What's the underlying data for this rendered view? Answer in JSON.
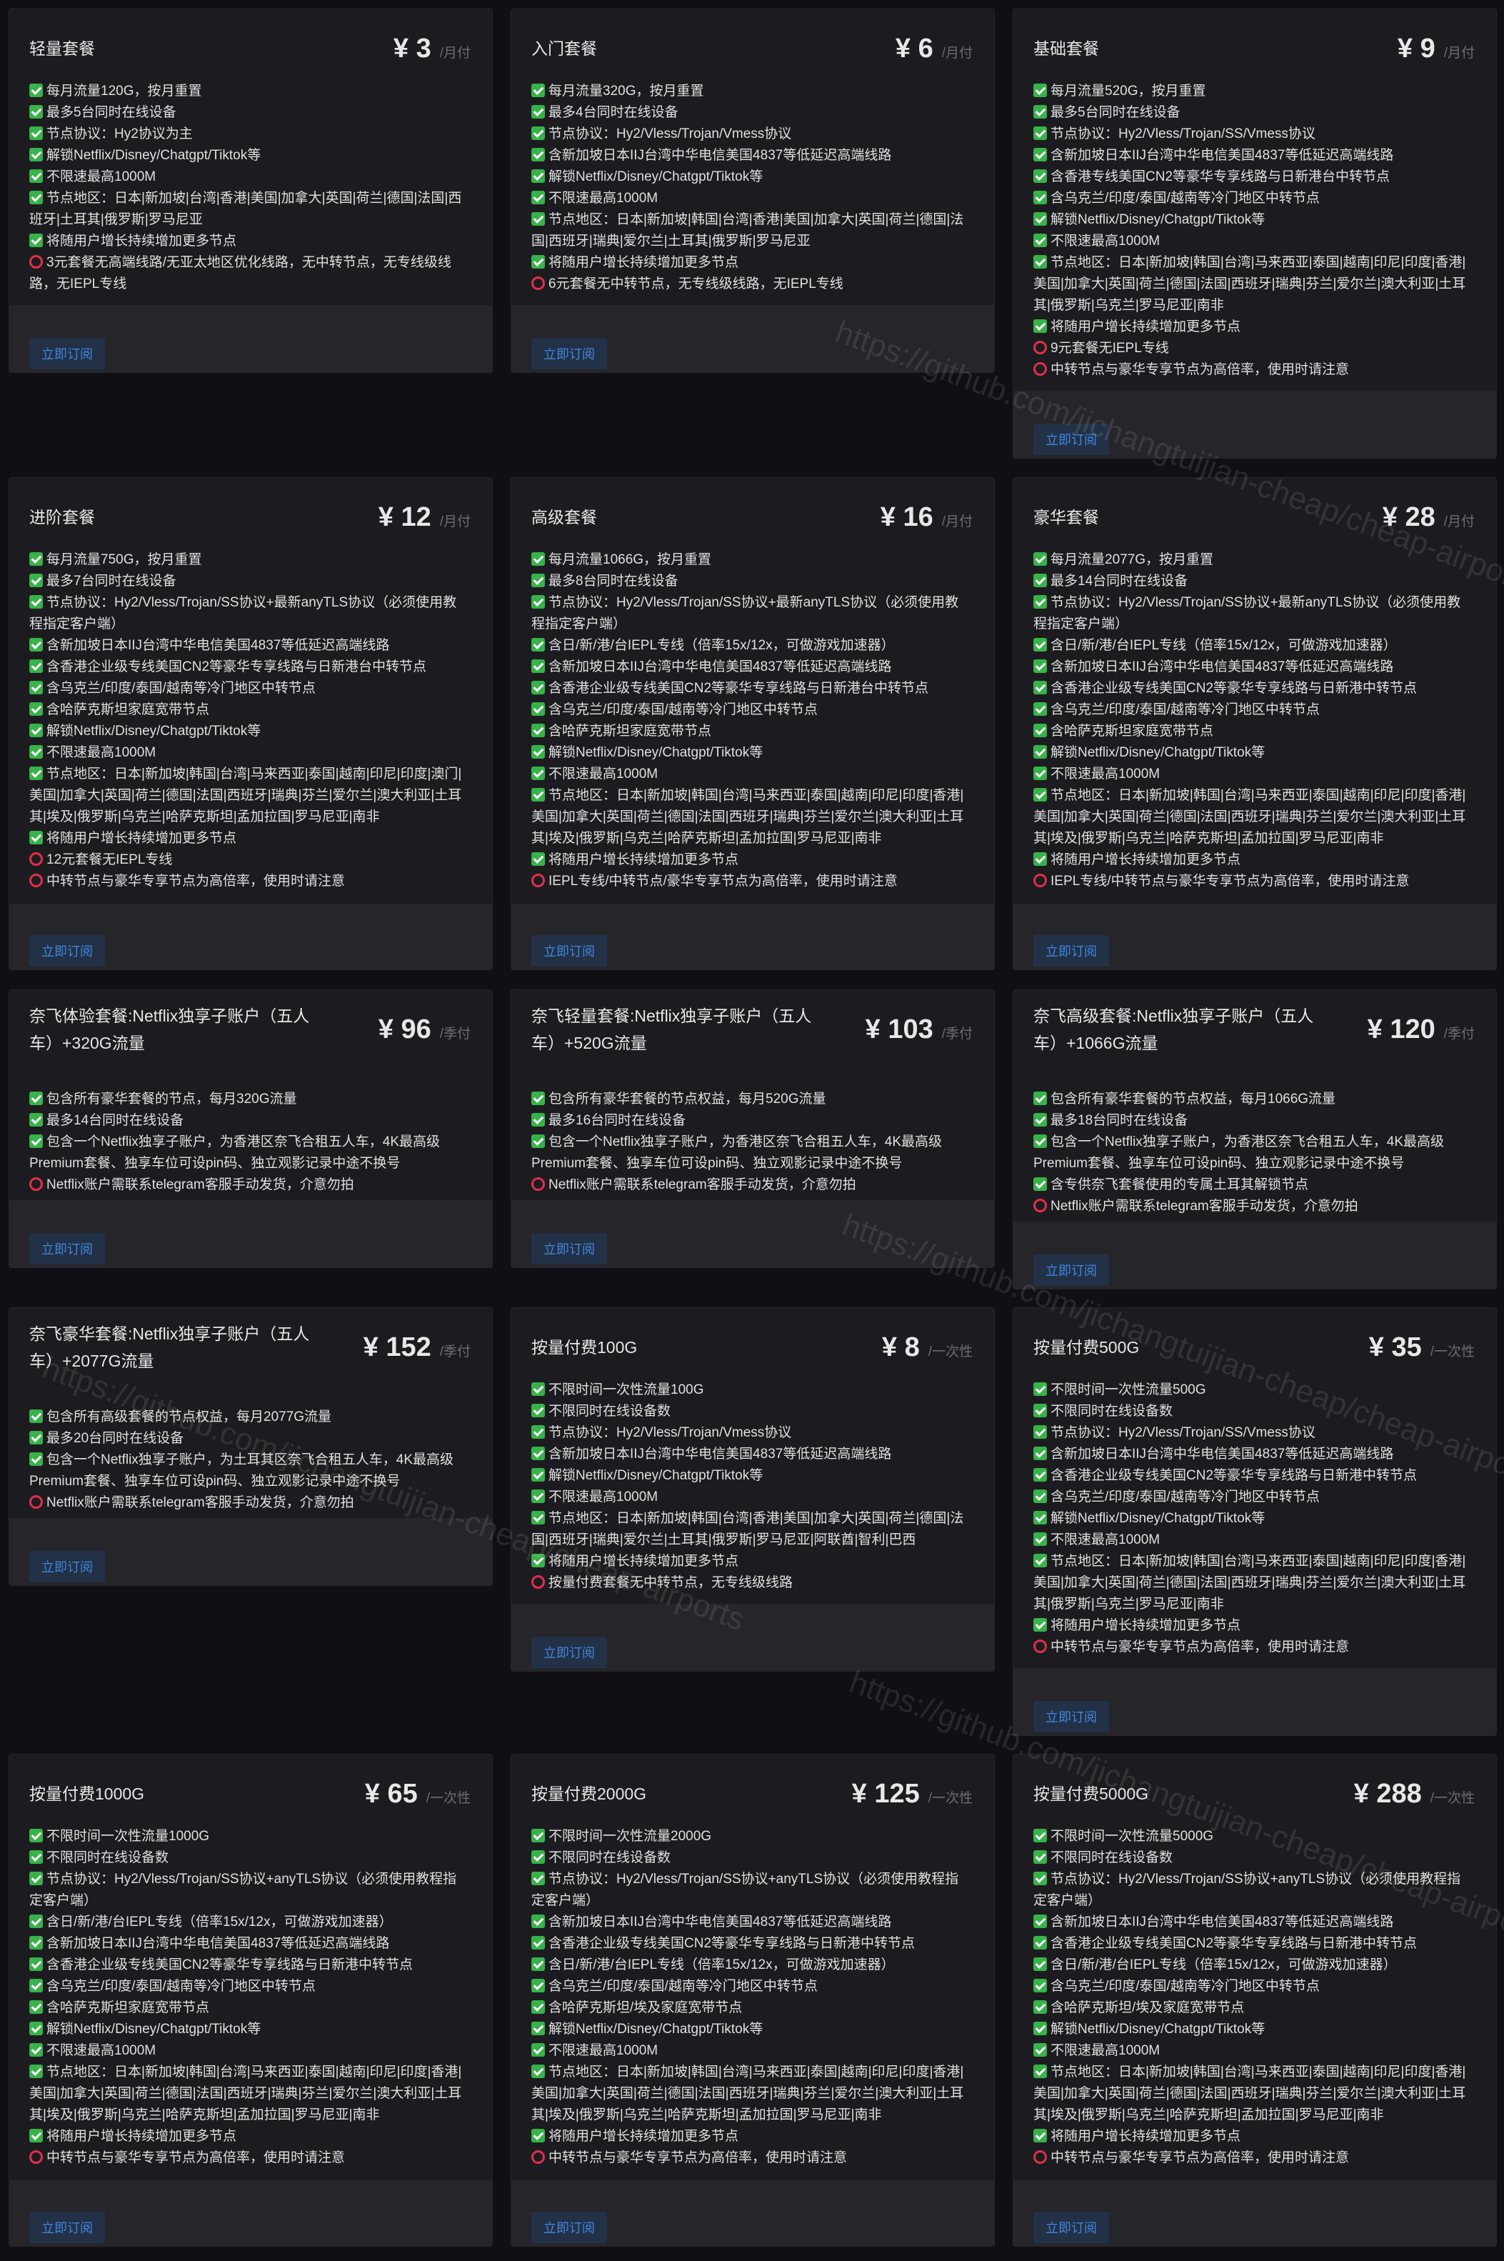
{
  "watermark": "https://github.com/jichangtuijian-cheap/cheap-airports",
  "colors": {
    "background": "#101014",
    "card": "#1c1c20",
    "check": "#38b24a",
    "circle": "#e0304a",
    "button_text": "#3f86e0",
    "button_bg": "#223146"
  },
  "icons": {
    "check": "check-square-icon",
    "circle": "red-circle-icon"
  },
  "plans": [
    {
      "title": "轻量套餐",
      "price": "¥ 3",
      "unit": "/月付",
      "button": "立即订阅",
      "features": [
        {
          "icon": "check",
          "text": "每月流量120G，按月重置"
        },
        {
          "icon": "check",
          "text": "最多5台同时在线设备"
        },
        {
          "icon": "check",
          "text": "节点协议：Hy2协议为主"
        },
        {
          "icon": "check",
          "text": "解锁Netflix/Disney/Chatgpt/Tiktok等"
        },
        {
          "icon": "check",
          "text": "不限速最高1000M"
        },
        {
          "icon": "check",
          "text": "节点地区：日本|新加坡|台湾|香港|美国|加拿大|英国|荷兰|德国|法国|西班牙|土耳其|俄罗斯|罗马尼亚"
        },
        {
          "icon": "check",
          "text": "将随用户增长持续增加更多节点"
        },
        {
          "icon": "circle",
          "text": "3元套餐无高端线路/无亚太地区优化线路，无中转节点，无专线级线路，无IEPL专线"
        }
      ]
    },
    {
      "title": "入门套餐",
      "price": "¥ 6",
      "unit": "/月付",
      "button": "立即订阅",
      "features": [
        {
          "icon": "check",
          "text": "每月流量320G，按月重置"
        },
        {
          "icon": "check",
          "text": "最多4台同时在线设备"
        },
        {
          "icon": "check",
          "text": "节点协议：Hy2/Vless/Trojan/Vmess协议"
        },
        {
          "icon": "check",
          "text": "含新加坡日本IIJ台湾中华电信美国4837等低延迟高端线路"
        },
        {
          "icon": "check",
          "text": "解锁Netflix/Disney/Chatgpt/Tiktok等"
        },
        {
          "icon": "check",
          "text": "不限速最高1000M"
        },
        {
          "icon": "check",
          "text": "节点地区：日本|新加坡|韩国|台湾|香港|美国|加拿大|英国|荷兰|德国|法国|西班牙|瑞典|爱尔兰|土耳其|俄罗斯|罗马尼亚"
        },
        {
          "icon": "check",
          "text": "将随用户增长持续增加更多节点"
        },
        {
          "icon": "circle",
          "text": "6元套餐无中转节点，无专线级线路，无IEPL专线"
        }
      ]
    },
    {
      "title": "基础套餐",
      "price": "¥ 9",
      "unit": "/月付",
      "button": "立即订阅",
      "features": [
        {
          "icon": "check",
          "text": "每月流量520G，按月重置"
        },
        {
          "icon": "check",
          "text": "最多5台同时在线设备"
        },
        {
          "icon": "check",
          "text": "节点协议：Hy2/Vless/Trojan/SS/Vmess协议"
        },
        {
          "icon": "check",
          "text": "含新加坡日本IIJ台湾中华电信美国4837等低延迟高端线路"
        },
        {
          "icon": "check",
          "text": "含香港专线美国CN2等豪华专享线路与日新港台中转节点"
        },
        {
          "icon": "check",
          "text": "含乌克兰/印度/泰国/越南等冷门地区中转节点"
        },
        {
          "icon": "check",
          "text": "解锁Netflix/Disney/Chatgpt/Tiktok等"
        },
        {
          "icon": "check",
          "text": "不限速最高1000M"
        },
        {
          "icon": "check",
          "text": "节点地区：日本|新加坡|韩国|台湾|马来西亚|泰国|越南|印尼|印度|香港|美国|加拿大|英国|荷兰|德国|法国|西班牙|瑞典|芬兰|爱尔兰|澳大利亚|土耳其|俄罗斯|乌克兰|罗马尼亚|南非"
        },
        {
          "icon": "check",
          "text": "将随用户增长持续增加更多节点"
        },
        {
          "icon": "circle",
          "text": "9元套餐无IEPL专线"
        },
        {
          "icon": "circle",
          "text": "中转节点与豪华专享节点为高倍率，使用时请注意"
        }
      ]
    },
    {
      "title": "进阶套餐",
      "price": "¥ 12",
      "unit": "/月付",
      "button": "立即订阅",
      "features": [
        {
          "icon": "check",
          "text": "每月流量750G，按月重置"
        },
        {
          "icon": "check",
          "text": "最多7台同时在线设备"
        },
        {
          "icon": "check",
          "text": "节点协议：Hy2/Vless/Trojan/SS协议+最新anyTLS协议（必须使用教程指定客户端）"
        },
        {
          "icon": "check",
          "text": "含新加坡日本IIJ台湾中华电信美国4837等低延迟高端线路"
        },
        {
          "icon": "check",
          "text": "含香港企业级专线美国CN2等豪华专享线路与日新港台中转节点"
        },
        {
          "icon": "check",
          "text": "含乌克兰/印度/泰国/越南等冷门地区中转节点"
        },
        {
          "icon": "check",
          "text": "含哈萨克斯坦家庭宽带节点"
        },
        {
          "icon": "check",
          "text": "解锁Netflix/Disney/Chatgpt/Tiktok等"
        },
        {
          "icon": "check",
          "text": "不限速最高1000M"
        },
        {
          "icon": "check",
          "text": "节点地区：日本|新加坡|韩国|台湾|马来西亚|泰国|越南|印尼|印度|澳门|美国|加拿大|英国|荷兰|德国|法国|西班牙|瑞典|芬兰|爱尔兰|澳大利亚|土耳其|埃及|俄罗斯|乌克兰|哈萨克斯坦|孟加拉国|罗马尼亚|南非"
        },
        {
          "icon": "check",
          "text": "将随用户增长持续增加更多节点"
        },
        {
          "icon": "circle",
          "text": "12元套餐无IEPL专线"
        },
        {
          "icon": "circle",
          "text": "中转节点与豪华专享节点为高倍率，使用时请注意"
        }
      ]
    },
    {
      "title": "高级套餐",
      "price": "¥ 16",
      "unit": "/月付",
      "button": "立即订阅",
      "features": [
        {
          "icon": "check",
          "text": "每月流量1066G，按月重置"
        },
        {
          "icon": "check",
          "text": "最多8台同时在线设备"
        },
        {
          "icon": "check",
          "text": "节点协议：Hy2/Vless/Trojan/SS协议+最新anyTLS协议（必须使用教程指定客户端）"
        },
        {
          "icon": "check",
          "text": "含日/新/港/台IEPL专线（倍率15x/12x，可做游戏加速器）"
        },
        {
          "icon": "check",
          "text": "含新加坡日本IIJ台湾中华电信美国4837等低延迟高端线路"
        },
        {
          "icon": "check",
          "text": "含香港企业级专线美国CN2等豪华专享线路与日新港台中转节点"
        },
        {
          "icon": "check",
          "text": "含乌克兰/印度/泰国/越南等冷门地区中转节点"
        },
        {
          "icon": "check",
          "text": "含哈萨克斯坦家庭宽带节点"
        },
        {
          "icon": "check",
          "text": "解锁Netflix/Disney/Chatgpt/Tiktok等"
        },
        {
          "icon": "check",
          "text": "不限速最高1000M"
        },
        {
          "icon": "check",
          "text": "节点地区：日本|新加坡|韩国|台湾|马来西亚|泰国|越南|印尼|印度|香港|美国|加拿大|英国|荷兰|德国|法国|西班牙|瑞典|芬兰|爱尔兰|澳大利亚|土耳其|埃及|俄罗斯|乌克兰|哈萨克斯坦|孟加拉国|罗马尼亚|南非"
        },
        {
          "icon": "check",
          "text": "将随用户增长持续增加更多节点"
        },
        {
          "icon": "circle",
          "text": "IEPL专线/中转节点/豪华专享节点为高倍率，使用时请注意"
        }
      ]
    },
    {
      "title": "豪华套餐",
      "price": "¥ 28",
      "unit": "/月付",
      "button": "立即订阅",
      "features": [
        {
          "icon": "check",
          "text": "每月流量2077G，按月重置"
        },
        {
          "icon": "check",
          "text": "最多14台同时在线设备"
        },
        {
          "icon": "check",
          "text": "节点协议：Hy2/Vless/Trojan/SS协议+最新anyTLS协议（必须使用教程指定客户端）"
        },
        {
          "icon": "check",
          "text": "含日/新/港/台IEPL专线（倍率15x/12x，可做游戏加速器）"
        },
        {
          "icon": "check",
          "text": "含新加坡日本IIJ台湾中华电信美国4837等低延迟高端线路"
        },
        {
          "icon": "check",
          "text": "含香港企业级专线美国CN2等豪华专享线路与日新港中转节点"
        },
        {
          "icon": "check",
          "text": "含乌克兰/印度/泰国/越南等冷门地区中转节点"
        },
        {
          "icon": "check",
          "text": "含哈萨克斯坦家庭宽带节点"
        },
        {
          "icon": "check",
          "text": "解锁Netflix/Disney/Chatgpt/Tiktok等"
        },
        {
          "icon": "check",
          "text": "不限速最高1000M"
        },
        {
          "icon": "check",
          "text": "节点地区：日本|新加坡|韩国|台湾|马来西亚|泰国|越南|印尼|印度|香港|美国|加拿大|英国|荷兰|德国|法国|西班牙|瑞典|芬兰|爱尔兰|澳大利亚|土耳其|埃及|俄罗斯|乌克兰|哈萨克斯坦|孟加拉国|罗马尼亚|南非"
        },
        {
          "icon": "check",
          "text": "将随用户增长持续增加更多节点"
        },
        {
          "icon": "circle",
          "text": "IEPL专线/中转节点与豪华专享节点为高倍率，使用时请注意"
        }
      ]
    },
    {
      "title": "奈飞体验套餐:Netflix独享子账户（五人车）+320G流量",
      "price": "¥ 96",
      "unit": "/季付",
      "button": "立即订阅",
      "features": [
        {
          "icon": "check",
          "text": "包含所有豪华套餐的节点，每月320G流量"
        },
        {
          "icon": "check",
          "text": "最多14台同时在线设备"
        },
        {
          "icon": "check",
          "text": "包含一个Netflix独享子账户，为香港区奈飞合租五人车，4K最高级Premium套餐、独享车位可设pin码、独立观影记录中途不换号"
        },
        {
          "icon": "circle",
          "text": "Netflix账户需联系telegram客服手动发货，介意勿拍"
        }
      ]
    },
    {
      "title": "奈飞轻量套餐:Netflix独享子账户（五人车）+520G流量",
      "price": "¥ 103",
      "unit": "/季付",
      "button": "立即订阅",
      "features": [
        {
          "icon": "check",
          "text": "包含所有豪华套餐的节点权益，每月520G流量"
        },
        {
          "icon": "check",
          "text": "最多16台同时在线设备"
        },
        {
          "icon": "check",
          "text": "包含一个Netflix独享子账户，为香港区奈飞合租五人车，4K最高级Premium套餐、独享车位可设pin码、独立观影记录中途不换号"
        },
        {
          "icon": "circle",
          "text": "Netflix账户需联系telegram客服手动发货，介意勿拍"
        }
      ]
    },
    {
      "title": "奈飞高级套餐:Netflix独享子账户（五人车）+1066G流量",
      "price": "¥ 120",
      "unit": "/季付",
      "button": "立即订阅",
      "features": [
        {
          "icon": "check",
          "text": "包含所有豪华套餐的节点权益，每月1066G流量"
        },
        {
          "icon": "check",
          "text": "最多18台同时在线设备"
        },
        {
          "icon": "check",
          "text": "包含一个Netflix独享子账户，为香港区奈飞合租五人车，4K最高级Premium套餐、独享车位可设pin码、独立观影记录中途不换号"
        },
        {
          "icon": "check",
          "text": "含专供奈飞套餐使用的专属土耳其解锁节点"
        },
        {
          "icon": "circle",
          "text": "Netflix账户需联系telegram客服手动发货，介意勿拍"
        }
      ]
    },
    {
      "title": "奈飞豪华套餐:Netflix独享子账户（五人车）+2077G流量",
      "price": "¥ 152",
      "unit": "/季付",
      "button": "立即订阅",
      "features": [
        {
          "icon": "check",
          "text": "包含所有高级套餐的节点权益，每月2077G流量"
        },
        {
          "icon": "check",
          "text": "最多20台同时在线设备"
        },
        {
          "icon": "check",
          "text": "包含一个Netflix独享子账户，为土耳其区奈飞合租五人车，4K最高级Premium套餐、独享车位可设pin码、独立观影记录中途不换号"
        },
        {
          "icon": "circle",
          "text": "Netflix账户需联系telegram客服手动发货，介意勿拍"
        }
      ]
    },
    {
      "title": "按量付费100G",
      "price": "¥ 8",
      "unit": "/一次性",
      "button": "立即订阅",
      "features": [
        {
          "icon": "check",
          "text": "不限时间一次性流量100G"
        },
        {
          "icon": "check",
          "text": "不限同时在线设备数"
        },
        {
          "icon": "check",
          "text": "节点协议：Hy2/Vless/Trojan/Vmess协议"
        },
        {
          "icon": "check",
          "text": "含新加坡日本IIJ台湾中华电信美国4837等低延迟高端线路"
        },
        {
          "icon": "check",
          "text": "解锁Netflix/Disney/Chatgpt/Tiktok等"
        },
        {
          "icon": "check",
          "text": "不限速最高1000M"
        },
        {
          "icon": "check",
          "text": "节点地区：日本|新加坡|韩国|台湾|香港|美国|加拿大|英国|荷兰|德国|法国|西班牙|瑞典|爱尔兰|土耳其|俄罗斯|罗马尼亚|阿联酋|智利|巴西"
        },
        {
          "icon": "check",
          "text": "将随用户增长持续增加更多节点"
        },
        {
          "icon": "circle",
          "text": "按量付费套餐无中转节点，无专线级线路"
        }
      ]
    },
    {
      "title": "按量付费500G",
      "price": "¥ 35",
      "unit": "/一次性",
      "button": "立即订阅",
      "features": [
        {
          "icon": "check",
          "text": "不限时间一次性流量500G"
        },
        {
          "icon": "check",
          "text": "不限同时在线设备数"
        },
        {
          "icon": "check",
          "text": "节点协议：Hy2/Vless/Trojan/SS/Vmess协议"
        },
        {
          "icon": "check",
          "text": "含新加坡日本IIJ台湾中华电信美国4837等低延迟高端线路"
        },
        {
          "icon": "check",
          "text": "含香港企业级专线美国CN2等豪华专享线路与日新港中转节点"
        },
        {
          "icon": "check",
          "text": "含乌克兰/印度/泰国/越南等冷门地区中转节点"
        },
        {
          "icon": "check",
          "text": "解锁Netflix/Disney/Chatgpt/Tiktok等"
        },
        {
          "icon": "check",
          "text": "不限速最高1000M"
        },
        {
          "icon": "check",
          "text": "节点地区：日本|新加坡|韩国|台湾|马来西亚|泰国|越南|印尼|印度|香港|美国|加拿大|英国|荷兰|德国|法国|西班牙|瑞典|芬兰|爱尔兰|澳大利亚|土耳其|俄罗斯|乌克兰|罗马尼亚|南非"
        },
        {
          "icon": "check",
          "text": "将随用户增长持续增加更多节点"
        },
        {
          "icon": "circle",
          "text": "中转节点与豪华专享节点为高倍率，使用时请注意"
        }
      ]
    },
    {
      "title": "按量付费1000G",
      "price": "¥ 65",
      "unit": "/一次性",
      "button": "立即订阅",
      "features": [
        {
          "icon": "check",
          "text": "不限时间一次性流量1000G"
        },
        {
          "icon": "check",
          "text": "不限同时在线设备数"
        },
        {
          "icon": "check",
          "text": "节点协议：Hy2/Vless/Trojan/SS协议+anyTLS协议（必须使用教程指定客户端）"
        },
        {
          "icon": "check",
          "text": "含日/新/港/台IEPL专线（倍率15x/12x，可做游戏加速器）"
        },
        {
          "icon": "check",
          "text": "含新加坡日本IIJ台湾中华电信美国4837等低延迟高端线路"
        },
        {
          "icon": "check",
          "text": "含香港企业级专线美国CN2等豪华专享线路与日新港中转节点"
        },
        {
          "icon": "check",
          "text": "含乌克兰/印度/泰国/越南等冷门地区中转节点"
        },
        {
          "icon": "check",
          "text": "含哈萨克斯坦家庭宽带节点"
        },
        {
          "icon": "check",
          "text": "解锁Netflix/Disney/Chatgpt/Tiktok等"
        },
        {
          "icon": "check",
          "text": "不限速最高1000M"
        },
        {
          "icon": "check",
          "text": "节点地区：日本|新加坡|韩国|台湾|马来西亚|泰国|越南|印尼|印度|香港|美国|加拿大|英国|荷兰|德国|法国|西班牙|瑞典|芬兰|爱尔兰|澳大利亚|土耳其|埃及|俄罗斯|乌克兰|哈萨克斯坦|孟加拉国|罗马尼亚|南非"
        },
        {
          "icon": "check",
          "text": "将随用户增长持续增加更多节点"
        },
        {
          "icon": "circle",
          "text": "中转节点与豪华专享节点为高倍率，使用时请注意"
        }
      ]
    },
    {
      "title": "按量付费2000G",
      "price": "¥ 125",
      "unit": "/一次性",
      "button": "立即订阅",
      "features": [
        {
          "icon": "check",
          "text": "不限时间一次性流量2000G"
        },
        {
          "icon": "check",
          "text": "不限同时在线设备数"
        },
        {
          "icon": "check",
          "text": "节点协议：Hy2/Vless/Trojan/SS协议+anyTLS协议（必须使用教程指定客户端）"
        },
        {
          "icon": "check",
          "text": "含新加坡日本IIJ台湾中华电信美国4837等低延迟高端线路"
        },
        {
          "icon": "check",
          "text": "含香港企业级专线美国CN2等豪华专享线路与日新港中转节点"
        },
        {
          "icon": "check",
          "text": "含日/新/港/台IEPL专线（倍率15x/12x，可做游戏加速器）"
        },
        {
          "icon": "check",
          "text": "含乌克兰/印度/泰国/越南等冷门地区中转节点"
        },
        {
          "icon": "check",
          "text": "含哈萨克斯坦/埃及家庭宽带节点"
        },
        {
          "icon": "check",
          "text": "解锁Netflix/Disney/Chatgpt/Tiktok等"
        },
        {
          "icon": "check",
          "text": "不限速最高1000M"
        },
        {
          "icon": "check",
          "text": "节点地区：日本|新加坡|韩国|台湾|马来西亚|泰国|越南|印尼|印度|香港|美国|加拿大|英国|荷兰|德国|法国|西班牙|瑞典|芬兰|爱尔兰|澳大利亚|土耳其|埃及|俄罗斯|乌克兰|哈萨克斯坦|孟加拉国|罗马尼亚|南非"
        },
        {
          "icon": "check",
          "text": "将随用户增长持续增加更多节点"
        },
        {
          "icon": "circle",
          "text": "中转节点与豪华专享节点为高倍率，使用时请注意"
        }
      ]
    },
    {
      "title": "按量付费5000G",
      "price": "¥ 288",
      "unit": "/一次性",
      "button": "立即订阅",
      "features": [
        {
          "icon": "check",
          "text": "不限时间一次性流量5000G"
        },
        {
          "icon": "check",
          "text": "不限同时在线设备数"
        },
        {
          "icon": "check",
          "text": "节点协议：Hy2/Vless/Trojan/SS协议+anyTLS协议（必须使用教程指定客户端）"
        },
        {
          "icon": "check",
          "text": "含新加坡日本IIJ台湾中华电信美国4837等低延迟高端线路"
        },
        {
          "icon": "check",
          "text": "含香港企业级专线美国CN2等豪华专享线路与日新港中转节点"
        },
        {
          "icon": "check",
          "text": "含日/新/港/台IEPL专线（倍率15x/12x，可做游戏加速器）"
        },
        {
          "icon": "check",
          "text": "含乌克兰/印度/泰国/越南等冷门地区中转节点"
        },
        {
          "icon": "check",
          "text": "含哈萨克斯坦/埃及家庭宽带节点"
        },
        {
          "icon": "check",
          "text": "解锁Netflix/Disney/Chatgpt/Tiktok等"
        },
        {
          "icon": "check",
          "text": "不限速最高1000M"
        },
        {
          "icon": "check",
          "text": "节点地区：日本|新加坡|韩国|台湾|马来西亚|泰国|越南|印尼|印度|香港|美国|加拿大|英国|荷兰|德国|法国|西班牙|瑞典|芬兰|爱尔兰|澳大利亚|土耳其|埃及|俄罗斯|乌克兰|哈萨克斯坦|孟加拉国|罗马尼亚|南非"
        },
        {
          "icon": "check",
          "text": "将随用户增长持续增加更多节点"
        },
        {
          "icon": "circle",
          "text": "中转节点与豪华专享节点为高倍率，使用时请注意"
        }
      ]
    }
  ]
}
